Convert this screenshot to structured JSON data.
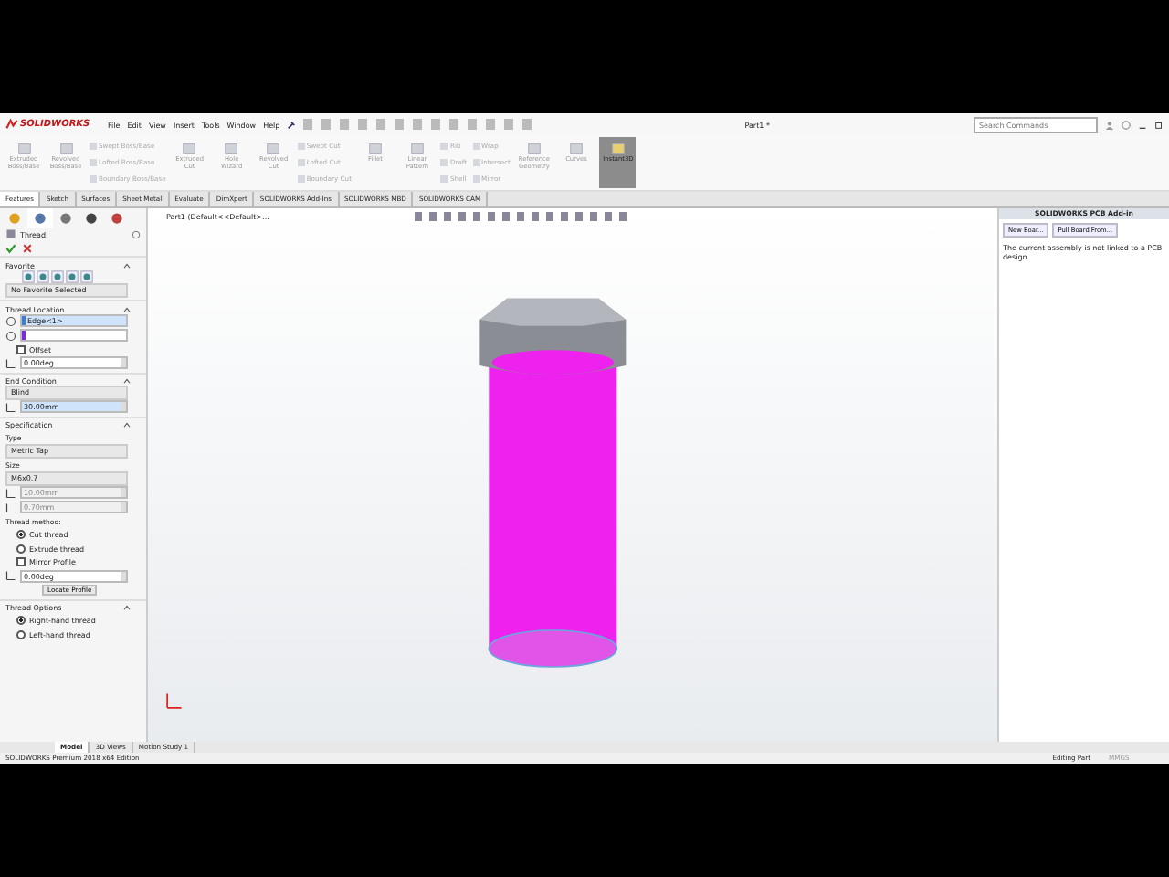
{
  "title_bar": {
    "logo": "SOLIDWORKS",
    "menu": [
      "File",
      "Edit",
      "View",
      "Insert",
      "Tools",
      "Window",
      "Help"
    ],
    "title": "Part1 *",
    "search": {
      "placeholder": "Search Commands"
    }
  },
  "ribbon": {
    "commands": [
      {
        "kind": "large",
        "label": "Extruded Boss/Base",
        "selected": false
      },
      {
        "kind": "large",
        "label": "Revolved Boss/Base",
        "selected": false
      },
      {
        "kind": "stack",
        "items": [
          "Swept Boss/Base",
          "Lofted Boss/Base",
          "Boundary Boss/Base"
        ]
      },
      {
        "kind": "large",
        "label": "Extruded Cut",
        "selected": false
      },
      {
        "kind": "large",
        "label": "Hole Wizard",
        "selected": false
      },
      {
        "kind": "large",
        "label": "Revolved Cut",
        "selected": false
      },
      {
        "kind": "stack",
        "items": [
          "Swept Cut",
          "Lofted Cut",
          "Boundary Cut"
        ]
      },
      {
        "kind": "large",
        "label": "Fillet",
        "selected": false
      },
      {
        "kind": "large",
        "label": "Linear Pattern",
        "selected": false
      },
      {
        "kind": "stack",
        "items": [
          "Rib",
          "Draft",
          "Shell"
        ]
      },
      {
        "kind": "stack",
        "items": [
          "Wrap",
          "Intersect",
          "Mirror"
        ]
      },
      {
        "kind": "large",
        "label": "Reference Geometry",
        "selected": false
      },
      {
        "kind": "large",
        "label": "Curves",
        "selected": false
      },
      {
        "kind": "large",
        "label": "Instant3D",
        "selected": true
      }
    ]
  },
  "command_tabs": [
    {
      "label": "Features",
      "selected": true
    },
    {
      "label": "Sketch",
      "selected": false
    },
    {
      "label": "Surfaces",
      "selected": false
    },
    {
      "label": "Sheet Metal",
      "selected": false
    },
    {
      "label": "Evaluate",
      "selected": false
    },
    {
      "label": "DimXpert",
      "selected": false
    },
    {
      "label": "SOLIDWORKS Add-Ins",
      "selected": false
    },
    {
      "label": "SOLIDWORKS MBD",
      "selected": false
    },
    {
      "label": "SOLIDWORKS CAM",
      "selected": false
    }
  ],
  "property_manager": {
    "title": "Thread",
    "sections": [
      {
        "title": "Favorite",
        "expanded": true,
        "rows": [
          {
            "kind": "icons"
          },
          {
            "kind": "dropdown",
            "value": "No Favorite Selected",
            "disabled": false
          }
        ]
      },
      {
        "title": "Thread Location",
        "expanded": true,
        "rows": [
          {
            "kind": "field",
            "value": "Edge<1>",
            "highlighted": true
          },
          {
            "kind": "field",
            "highlighted": false
          },
          {
            "kind": "checkbox",
            "label": "Offset",
            "checked": false
          },
          {
            "kind": "spin",
            "value": "0.00deg",
            "disabled": false
          }
        ]
      },
      {
        "title": "End Condition",
        "expanded": true,
        "rows": [
          {
            "kind": "dropdown",
            "value": "Blind",
            "disabled": false
          },
          {
            "kind": "spin",
            "value": "30.00mm",
            "disabled": false,
            "highlighted": true
          }
        ]
      },
      {
        "title": "Specification",
        "expanded": true,
        "rows": [
          {
            "kind": "label",
            "text": "Type"
          },
          {
            "kind": "dropdown",
            "value": "Metric Tap",
            "disabled": false
          },
          {
            "kind": "label",
            "text": "Size"
          },
          {
            "kind": "dropdown",
            "value": "M6x0.7",
            "disabled": false
          },
          {
            "kind": "spin",
            "value": "10.00mm",
            "disabled": true
          },
          {
            "kind": "spin",
            "value": "0.70mm",
            "disabled": true
          },
          {
            "kind": "label",
            "text": "Thread method:"
          },
          {
            "kind": "radio",
            "label": "Cut thread",
            "selected": true
          },
          {
            "kind": "radio",
            "label": "Extrude thread",
            "selected": false
          },
          {
            "kind": "checkbox",
            "label": "Mirror Profile",
            "checked": false
          },
          {
            "kind": "spin",
            "value": "0.00deg",
            "disabled": false
          },
          {
            "kind": "button",
            "label": "Locate Profile"
          }
        ]
      },
      {
        "title": "Thread Options",
        "expanded": true,
        "rows": [
          {
            "kind": "radio",
            "label": "Right-hand thread",
            "selected": true
          },
          {
            "kind": "radio",
            "label": "Left-hand thread",
            "selected": false
          }
        ]
      }
    ]
  },
  "viewport": {
    "tree_item": "Part1  (Default<<Default>..."
  },
  "side_panel": {
    "title": "SOLIDWORKS PCB Add-in",
    "buttons": [
      "New Boar...",
      "Pull Board From..."
    ],
    "message": "The current assembly is not linked to a PCB design."
  },
  "bottom_tabs": [
    {
      "label": "Model",
      "selected": true
    },
    {
      "label": "3D Views",
      "selected": false
    },
    {
      "label": "Motion Study 1",
      "selected": false
    }
  ],
  "status_bar": {
    "edition": "SOLIDWORKS Premium 2018 x64 Edition",
    "mode": "Editing Part",
    "units": "MMGS"
  }
}
